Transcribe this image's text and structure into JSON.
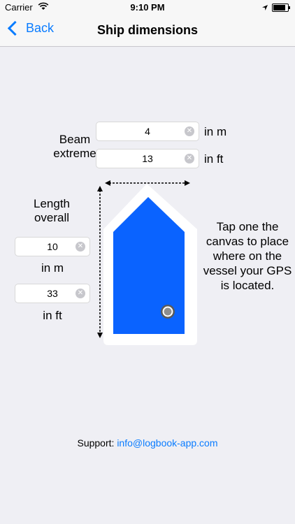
{
  "status_bar": {
    "carrier": "Carrier",
    "time": "9:10 PM",
    "battery_percent": 95
  },
  "navbar": {
    "back_label": "Back",
    "title": "Ship dimensions"
  },
  "beam": {
    "label_line1": "Beam",
    "label_line2": "extreme",
    "meters_value": "4",
    "meters_unit": "in m",
    "feet_value": "13",
    "feet_unit": "in ft"
  },
  "length": {
    "label_line1": "Length",
    "label_line2": "overall",
    "meters_value": "10",
    "meters_unit": "in m",
    "feet_value": "33",
    "feet_unit": "in ft"
  },
  "hint": "Tap one the canvas to place where on the vessel your GPS is located.",
  "support": {
    "label": "Support:",
    "email": "info@logbook-app.com"
  },
  "colors": {
    "accent": "#0a7cff",
    "vessel": "#0a63ff",
    "background": "#efeff4"
  }
}
